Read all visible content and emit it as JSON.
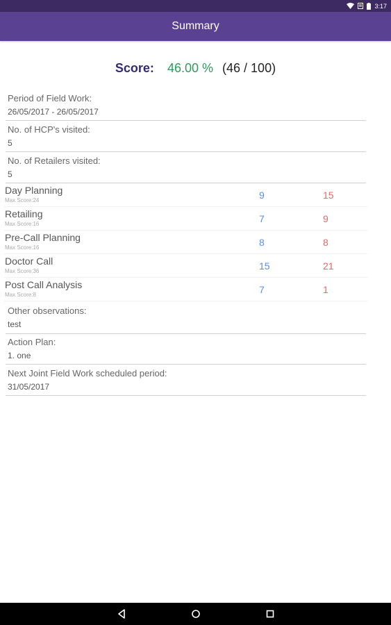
{
  "status": {
    "time": "3:17"
  },
  "app_bar": {
    "title": "Summary"
  },
  "score": {
    "label": "Score:",
    "percent": "46.00 %",
    "raw": "(46 / 100)"
  },
  "info_top": [
    {
      "label": "Period of Field Work:",
      "value": "26/05/2017 - 26/05/2017"
    },
    {
      "label": "No. of HCP's visited:",
      "value": "5"
    },
    {
      "label": "No. of Retailers visited:",
      "value": "5"
    }
  ],
  "sections": [
    {
      "name": "Day Planning",
      "max": "Max Score:24",
      "a": "9",
      "b": "15"
    },
    {
      "name": "Retailing",
      "max": "Max Score:16",
      "a": "7",
      "b": "9"
    },
    {
      "name": "Pre-Call Planning",
      "max": "Max Score:16",
      "a": "8",
      "b": "8"
    },
    {
      "name": "Doctor Call",
      "max": "Max Score:36",
      "a": "15",
      "b": "21"
    },
    {
      "name": "Post Call Analysis",
      "max": "Max Score:8",
      "a": "7",
      "b": "1"
    }
  ],
  "info_bottom": [
    {
      "label": "Other observations:",
      "value": "test"
    },
    {
      "label": "Action Plan:",
      "value": "1. one"
    },
    {
      "label": "Next Joint Field Work scheduled period:",
      "value": "31/05/2017"
    }
  ],
  "colors": {
    "app_bar": "#5b4192",
    "status_bar": "#3e2a63",
    "score_green": "#2e9a5a",
    "value_blue": "#5b8de6",
    "value_red": "#e06a6a"
  },
  "icons": {
    "nav": [
      "back-icon",
      "home-icon",
      "recents-icon"
    ],
    "status": [
      "wifi-icon",
      "battery-icon",
      "notification-icon"
    ]
  }
}
